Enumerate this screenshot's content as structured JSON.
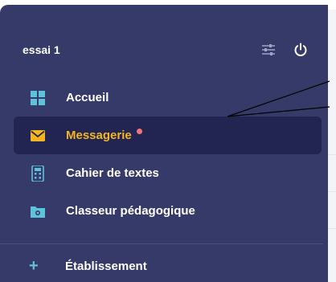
{
  "header": {
    "title": "essai 1",
    "filter_icon": "sliders-icon",
    "power_icon": "power-icon"
  },
  "menu": {
    "items": [
      {
        "label": "Accueil",
        "icon": "grid-icon",
        "active": false
      },
      {
        "label": "Messagerie",
        "icon": "envelope-icon",
        "active": true,
        "notification": true
      },
      {
        "label": "Cahier de textes",
        "icon": "calculator-icon",
        "active": false
      },
      {
        "label": "Classeur pédagogique",
        "icon": "folder-icon",
        "active": false
      }
    ]
  },
  "footer": {
    "label": "Établissement",
    "icon": "plus-icon"
  },
  "colors": {
    "sidebar_bg": "#363a69",
    "active_bg": "#222551",
    "active_text": "#f5b521",
    "accent_blue": "#5ec2da",
    "notification": "#f0767b"
  }
}
